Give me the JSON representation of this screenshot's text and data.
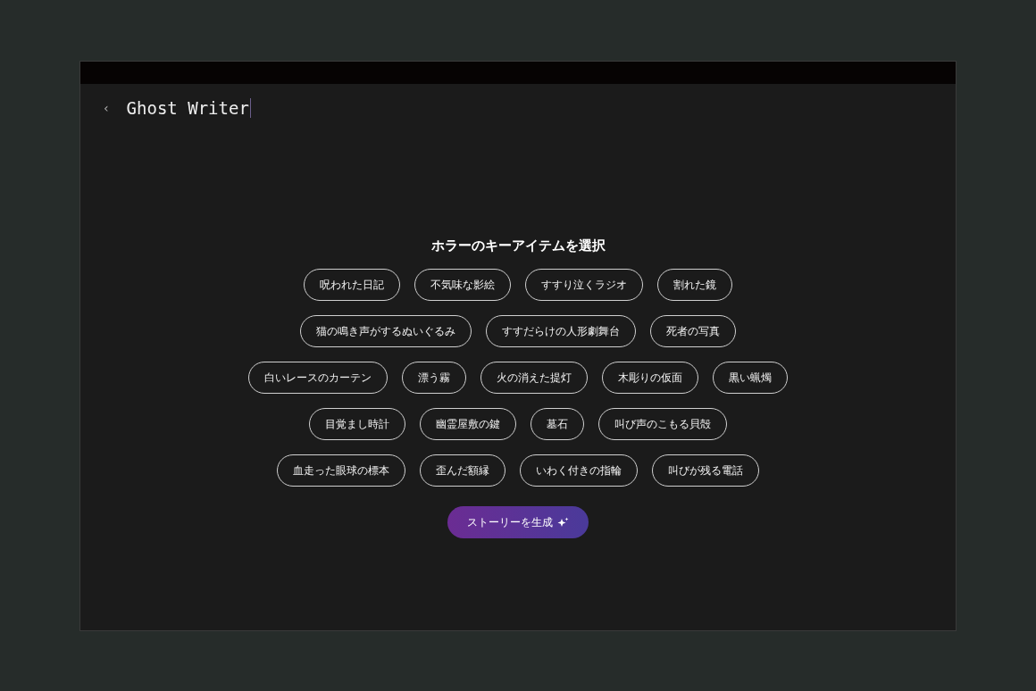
{
  "header": {
    "back": "‹",
    "title": "Ghost Writer"
  },
  "heading": "ホラーのキーアイテムを選択",
  "item_rows": [
    [
      {
        "label": "呪われた日記",
        "selected": false
      },
      {
        "label": "不気味な影絵",
        "selected": false
      },
      {
        "label": "すすり泣くラジオ",
        "selected": false
      },
      {
        "label": "割れた鏡",
        "selected": false
      }
    ],
    [
      {
        "label": "猫の鳴き声がするぬいぐるみ",
        "selected": false
      },
      {
        "label": "すすだらけの人形劇舞台",
        "selected": false
      },
      {
        "label": "死者の写真",
        "selected": false
      }
    ],
    [
      {
        "label": "白いレースのカーテン",
        "selected": false
      },
      {
        "label": "漂う霧",
        "selected": false
      },
      {
        "label": "火の消えた提灯",
        "selected": false
      },
      {
        "label": "木彫りの仮面",
        "selected": false
      },
      {
        "label": "黒い蝋燭",
        "selected": false
      }
    ],
    [
      {
        "label": "目覚まし時計",
        "selected": false
      },
      {
        "label": "幽霊屋敷の鍵",
        "selected": false
      },
      {
        "label": "墓石",
        "selected": false
      },
      {
        "label": "叫び声のこもる貝殻",
        "selected": false
      }
    ],
    [
      {
        "label": "血走った眼球の標本",
        "selected": false
      },
      {
        "label": "歪んだ額縁",
        "selected": false
      },
      {
        "label": "いわく付きの指輪",
        "selected": false
      },
      {
        "label": "叫びが残る電話",
        "selected": false
      }
    ]
  ],
  "generate_button": "ストーリーを生成"
}
